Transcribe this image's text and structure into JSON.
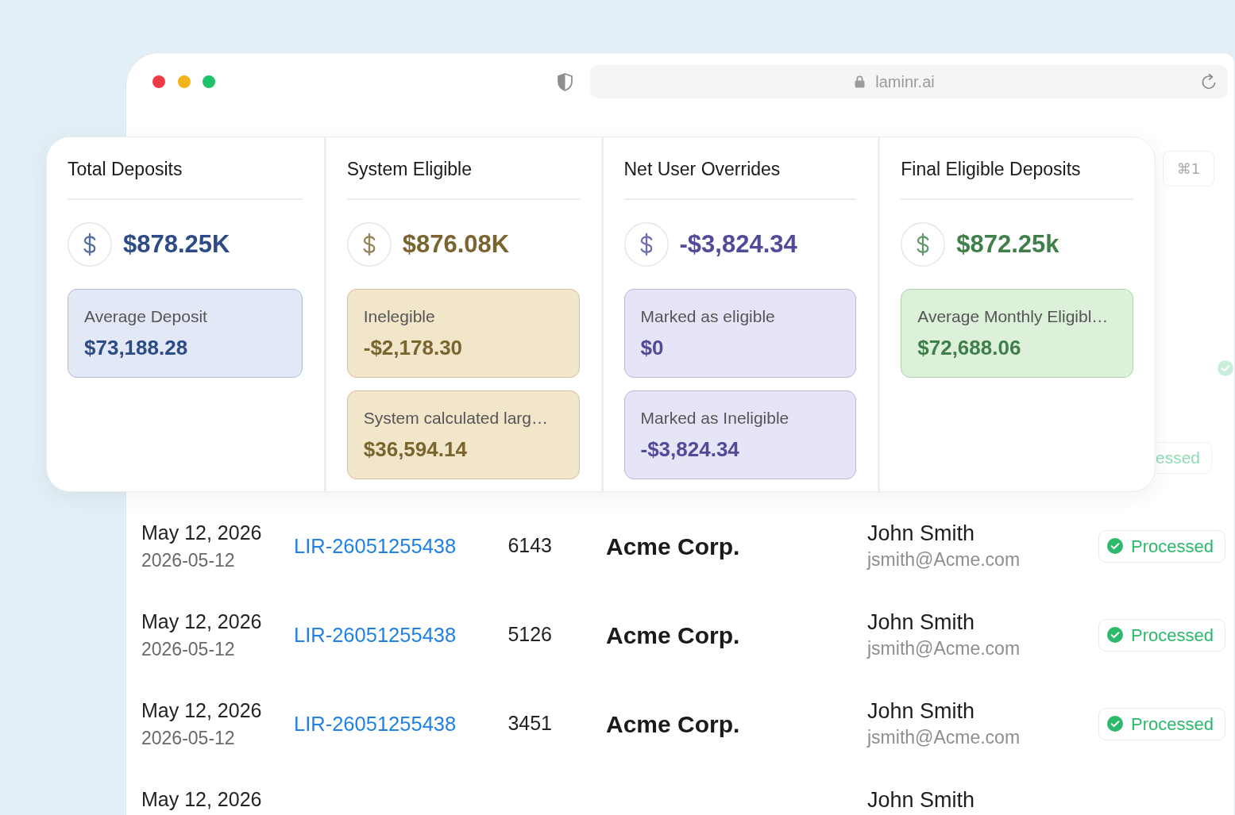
{
  "browser": {
    "url": "laminr.ai"
  },
  "summary_cards": [
    {
      "title": "Total Deposits",
      "value": "$878.25K",
      "color": "#2d4b86",
      "details": [
        {
          "label": "Average Deposit",
          "value": "$73,188.28",
          "color": "#e2e8f6"
        }
      ]
    },
    {
      "title": "System Eligible",
      "value": "$876.08K",
      "color": "#7a6530",
      "details": [
        {
          "label": "Inelegible",
          "value": "-$2,178.30",
          "color": "#f1e6c9"
        },
        {
          "label": "System calculated larg…",
          "value": "$36,594.14",
          "color": "#f1e6c9"
        }
      ]
    },
    {
      "title": "Net User Overrides",
      "value": "-$3,824.34",
      "color": "#4e4b98",
      "details": [
        {
          "label": "Marked as eligible",
          "value": "$0",
          "color": "#e6e5f7"
        },
        {
          "label": "Marked as Ineligible",
          "value": "-$3,824.34",
          "color": "#e6e5f7"
        }
      ]
    },
    {
      "title": "Final Eligible Deposits",
      "value": "$872.25k",
      "color": "#3f7f4a",
      "details": [
        {
          "label": "Average Monthly Eligibl…",
          "value": "$72,688.06",
          "color": "#dcf0da"
        }
      ]
    }
  ],
  "background": {
    "shortcut": "⌘1",
    "status_fragment": "essed"
  },
  "rows": [
    {
      "date": "May 12, 2026",
      "date_iso": "2026-05-12",
      "id": "LIR-26051255438",
      "number": "6143",
      "company": "Acme Corp.",
      "name": "John Smith",
      "email": "jsmith@Acme.com",
      "status": "Processed"
    },
    {
      "date": "May 12, 2026",
      "date_iso": "2026-05-12",
      "id": "LIR-26051255438",
      "number": "5126",
      "company": "Acme Corp.",
      "name": "John Smith",
      "email": "jsmith@Acme.com",
      "status": "Processed"
    },
    {
      "date": "May 12, 2026",
      "date_iso": "2026-05-12",
      "id": "LIR-26051255438",
      "number": "3451",
      "company": "Acme Corp.",
      "name": "John Smith",
      "email": "jsmith@Acme.com",
      "status": "Processed"
    },
    {
      "date": "May 12, 2026",
      "name": "John Smith"
    }
  ]
}
